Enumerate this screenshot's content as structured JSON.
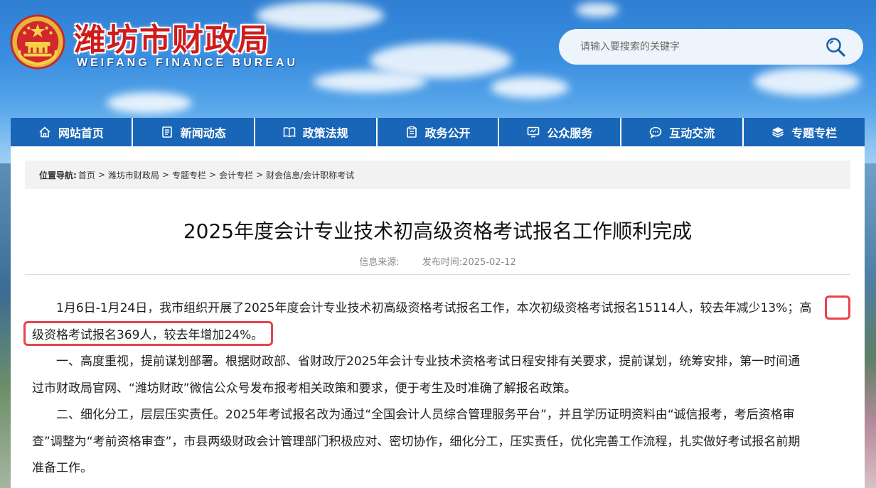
{
  "header": {
    "title": "潍坊市财政局",
    "subtitle": "WEIFANG FINANCE BUREAU",
    "search_placeholder": "请输入要搜索的关键字"
  },
  "nav": {
    "items": [
      {
        "label": "网站首页",
        "icon": "home-icon"
      },
      {
        "label": "新闻动态",
        "icon": "document-icon"
      },
      {
        "label": "政策法规",
        "icon": "book-icon"
      },
      {
        "label": "政务公开",
        "icon": "clipboard-icon"
      },
      {
        "label": "公众服务",
        "icon": "monitor-icon"
      },
      {
        "label": "互动交流",
        "icon": "chat-icon"
      },
      {
        "label": "专题专栏",
        "icon": "layers-icon"
      }
    ]
  },
  "breadcrumb": {
    "label": "位置导航:",
    "items": [
      "首页",
      "潍坊市财政局",
      "专题专栏",
      "会计专栏",
      "财会信息/会计职称考试"
    ]
  },
  "article": {
    "title": "2025年度会计专业技术初高级资格考试报名工作顺利完成",
    "source_label": "信息来源:",
    "date_label": "发布时间:",
    "date": "2025-02-12",
    "p1_lead": "1月6日-1月24日，我市组织开展了2025年度会计专业技术初高级资格考试报名工作，本次初级资格考试报名15114人，较去年减少13%；",
    "p1_hl_a": "高",
    "p1_hl_b": "级资格考试报名369人，较去年增加24%。",
    "p2_a": "一、高度重视，提前谋划部署。根据财政部、省财政厅2025年会计专业技术资格考试日程安排有关要求，提前谋划，统筹安排，第一时间通",
    "p2_b": "过市财政局官网、“潍坊财政”微信公众号发布报考相关政策和要求，便于考生及时准确了解报名政策。",
    "p3_a": "二、细化分工，层层压实责任。2025年考试报名改为通过“全国会计人员综合管理服务平台”，并且学历证明资料由“诚信报考，考后资格审",
    "p3_b": "查”调整为“考前资格审查”，市县两级财政会计管理部门积极应对、密切协作，细化分工，压实责任，优化完善工作流程，扎实做好考试报名前期",
    "p3_c": "准备工作。"
  },
  "colors": {
    "brand_red": "#d01b1b",
    "nav_blue": "#1966b8",
    "highlight_red": "#e8424d"
  }
}
